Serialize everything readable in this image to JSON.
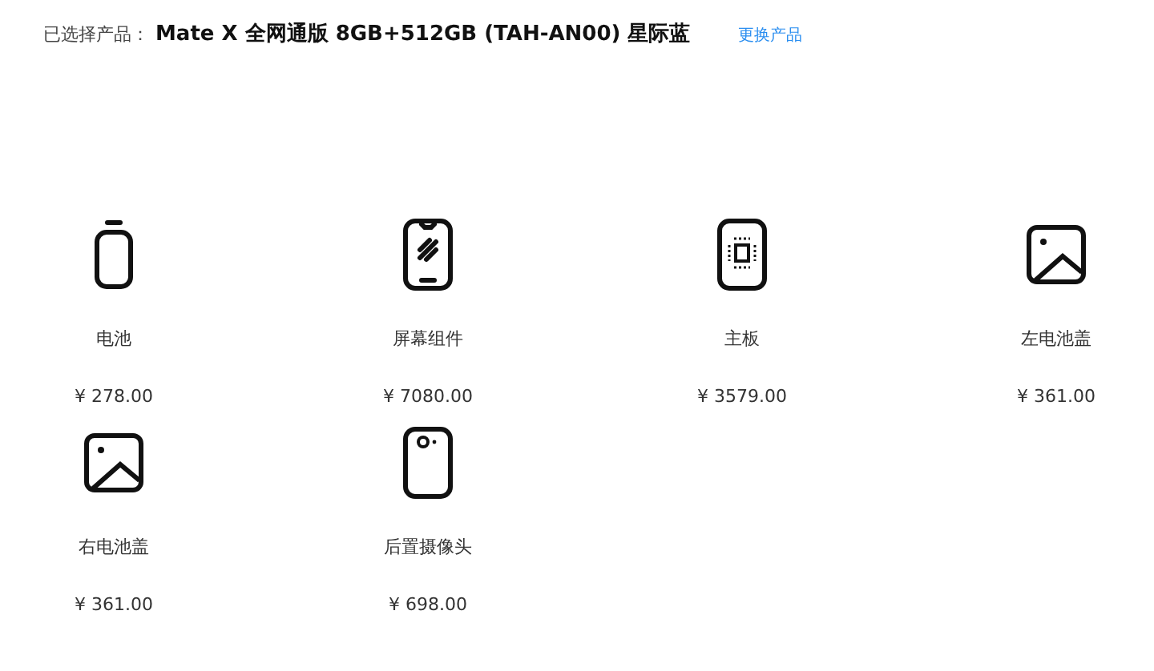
{
  "header": {
    "label": "已选择产品：",
    "product": "Mate X 全网通版 8GB+512GB (TAH-AN00) 星际蓝",
    "change_link": "更换产品"
  },
  "parts": [
    {
      "kind": "battery",
      "name": "电池",
      "price": "¥ 278.00"
    },
    {
      "kind": "screen",
      "name": "屏幕组件",
      "price": "¥ 7080.00"
    },
    {
      "kind": "board",
      "name": "主板",
      "price": "¥ 3579.00"
    },
    {
      "kind": "image",
      "name": "左电池盖",
      "price": "¥ 361.00"
    },
    {
      "kind": "image",
      "name": "右电池盖",
      "price": "¥ 361.00"
    },
    {
      "kind": "camera",
      "name": "后置摄像头",
      "price": "¥ 698.00"
    }
  ]
}
